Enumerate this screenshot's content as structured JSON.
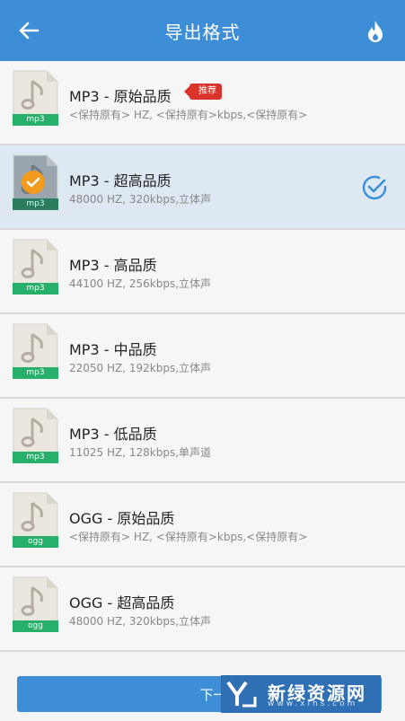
{
  "header": {
    "title": "导出格式",
    "back_icon": "arrow-left-icon",
    "action_icon": "flame-icon"
  },
  "formats": [
    {
      "name": "MP3 - 原始品质",
      "detail": "<保持原有> HZ, <保持原有>kbps,<保持原有>",
      "ext": "mp3",
      "badge": "推荐",
      "selected": false
    },
    {
      "name": "MP3 - 超高品质",
      "detail": "48000 HZ, 320kbps,立体声",
      "ext": "mp3",
      "selected": true
    },
    {
      "name": "MP3 - 高品质",
      "detail": "44100 HZ, 256kbps,立体声",
      "ext": "mp3",
      "selected": false
    },
    {
      "name": "MP3 - 中品质",
      "detail": "22050 HZ, 192kbps,立体声",
      "ext": "mp3",
      "selected": false
    },
    {
      "name": "MP3 - 低品质",
      "detail": "11025 HZ, 128kbps,单声道",
      "ext": "mp3",
      "selected": false
    },
    {
      "name": "OGG - 原始品质",
      "detail": "<保持原有> HZ, <保持原有>kbps,<保持原有>",
      "ext": "ogg",
      "selected": false
    },
    {
      "name": "OGG - 超高品质",
      "detail": "48000 HZ, 320kbps,立体声",
      "ext": "ogg",
      "selected": false
    }
  ],
  "footer": {
    "next_label": "下一步"
  },
  "watermark": {
    "brand": "新绿资源网",
    "url": "www.xlhs.com"
  },
  "colors": {
    "primary": "#3d8ed6",
    "selected_bg": "#dde8f2",
    "badge": "#d9342b",
    "ext_tag": "#27b06a",
    "check_orange": "#f29b1f"
  }
}
